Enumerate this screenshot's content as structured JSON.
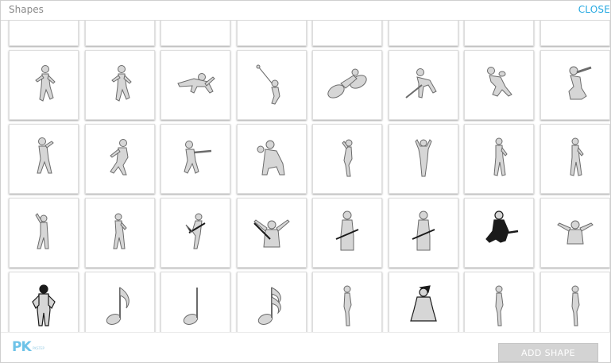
{
  "dialog": {
    "title": "Shapes",
    "close_label": "CLOSE"
  },
  "footer": {
    "logo_text": "PK",
    "logo_subtext": "PKSTEP",
    "add_shape_label": "ADD SHAPE"
  },
  "colors": {
    "accent": "#27a9e1",
    "silhouette_fill": "#d6d6d6",
    "silhouette_stroke": "#6b6b6b",
    "dark_fill": "#1a1a1a",
    "button_bg": "#d3d3d3"
  },
  "tiles": [
    {
      "icon": "person-partial-icon"
    },
    {
      "icon": "person-partial-icon"
    },
    {
      "icon": "person-partial-icon"
    },
    {
      "icon": "person-partial-icon"
    },
    {
      "icon": "person-partial-icon"
    },
    {
      "icon": "person-partial-icon"
    },
    {
      "icon": "person-partial-icon"
    },
    {
      "icon": "person-partial-icon"
    },
    {
      "icon": "runner-icon"
    },
    {
      "icon": "runner-icon"
    },
    {
      "icon": "high-jump-icon"
    },
    {
      "icon": "hammer-throw-icon"
    },
    {
      "icon": "cyclist-icon"
    },
    {
      "icon": "field-hockey-icon"
    },
    {
      "icon": "rugby-player-icon"
    },
    {
      "icon": "cricket-batsman-icon"
    },
    {
      "icon": "baseball-batter-icon"
    },
    {
      "icon": "baseball-pitcher-icon"
    },
    {
      "icon": "baseball-swing-icon"
    },
    {
      "icon": "baseball-catcher-icon"
    },
    {
      "icon": "woman-pose-icon"
    },
    {
      "icon": "woman-hands-on-head-icon"
    },
    {
      "icon": "dancer-icon"
    },
    {
      "icon": "dancer-icon"
    },
    {
      "icon": "disco-dancer-icon"
    },
    {
      "icon": "woman-dancer-icon"
    },
    {
      "icon": "guitarist-jump-icon"
    },
    {
      "icon": "guitarist-raise-icon"
    },
    {
      "icon": "guitarist-icon"
    },
    {
      "icon": "guitarist-icon"
    },
    {
      "icon": "guitarist-jump-dark-icon"
    },
    {
      "icon": "arms-raised-icon"
    },
    {
      "icon": "man-hands-hips-dark-icon"
    },
    {
      "icon": "eighth-note-icon"
    },
    {
      "icon": "half-note-icon"
    },
    {
      "icon": "sixteenth-note-icon"
    },
    {
      "icon": "woman-standing-icon"
    },
    {
      "icon": "woman-hood-dark-icon"
    },
    {
      "icon": "woman-standing-icon"
    },
    {
      "icon": "woman-standing-icon"
    }
  ]
}
